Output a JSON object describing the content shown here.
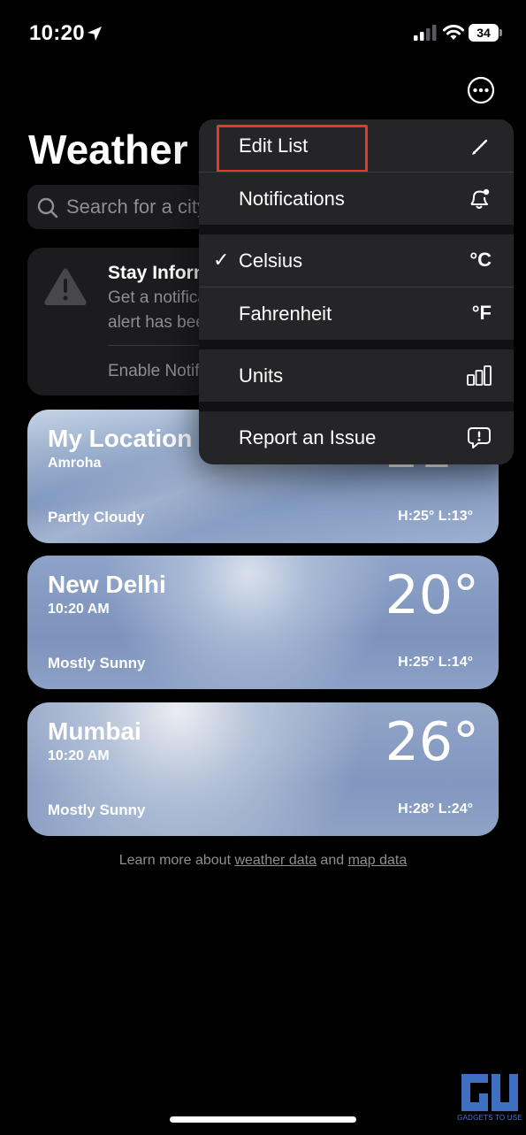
{
  "status_bar": {
    "time": "10:20",
    "battery": "34"
  },
  "header": {
    "title": "Weather"
  },
  "search": {
    "placeholder": "Search for a city or airport"
  },
  "info_card": {
    "title": "Stay Informed",
    "line1": "Get a notification if a severe weather",
    "line2": "alert has been issued in your area.",
    "action": "Enable Notifications"
  },
  "cities": [
    {
      "name": "My Location",
      "sub": "Amroha",
      "temp": "21°",
      "condition": "Partly Cloudy",
      "hilo": "H:25°  L:13°"
    },
    {
      "name": "New Delhi",
      "sub": "10:20 AM",
      "temp": "20°",
      "condition": "Mostly Sunny",
      "hilo": "H:25°  L:14°"
    },
    {
      "name": "Mumbai",
      "sub": "10:20 AM",
      "temp": "26°",
      "condition": "Mostly Sunny",
      "hilo": "H:28°  L:24°"
    }
  ],
  "footer": {
    "prefix": "Learn more about ",
    "link1": "weather data",
    "middle": " and ",
    "link2": "map data"
  },
  "menu": {
    "items": [
      {
        "label": "Edit List",
        "icon": "pencil-icon"
      },
      {
        "label": "Notifications",
        "icon": "bell-badge-icon"
      },
      {
        "label": "Celsius",
        "icon_text": "°C",
        "checked": true
      },
      {
        "label": "Fahrenheit",
        "icon_text": "°F"
      },
      {
        "label": "Units",
        "icon": "chart-bars-icon"
      },
      {
        "label": "Report an Issue",
        "icon": "exclamation-bubble-icon"
      }
    ],
    "check_mark": "✓"
  },
  "watermark": {
    "text": "GADGETS TO USE"
  },
  "colors": {
    "highlight": "#e5382d",
    "menu_bg": "#252527",
    "card_bg": "#1c1c1e"
  }
}
